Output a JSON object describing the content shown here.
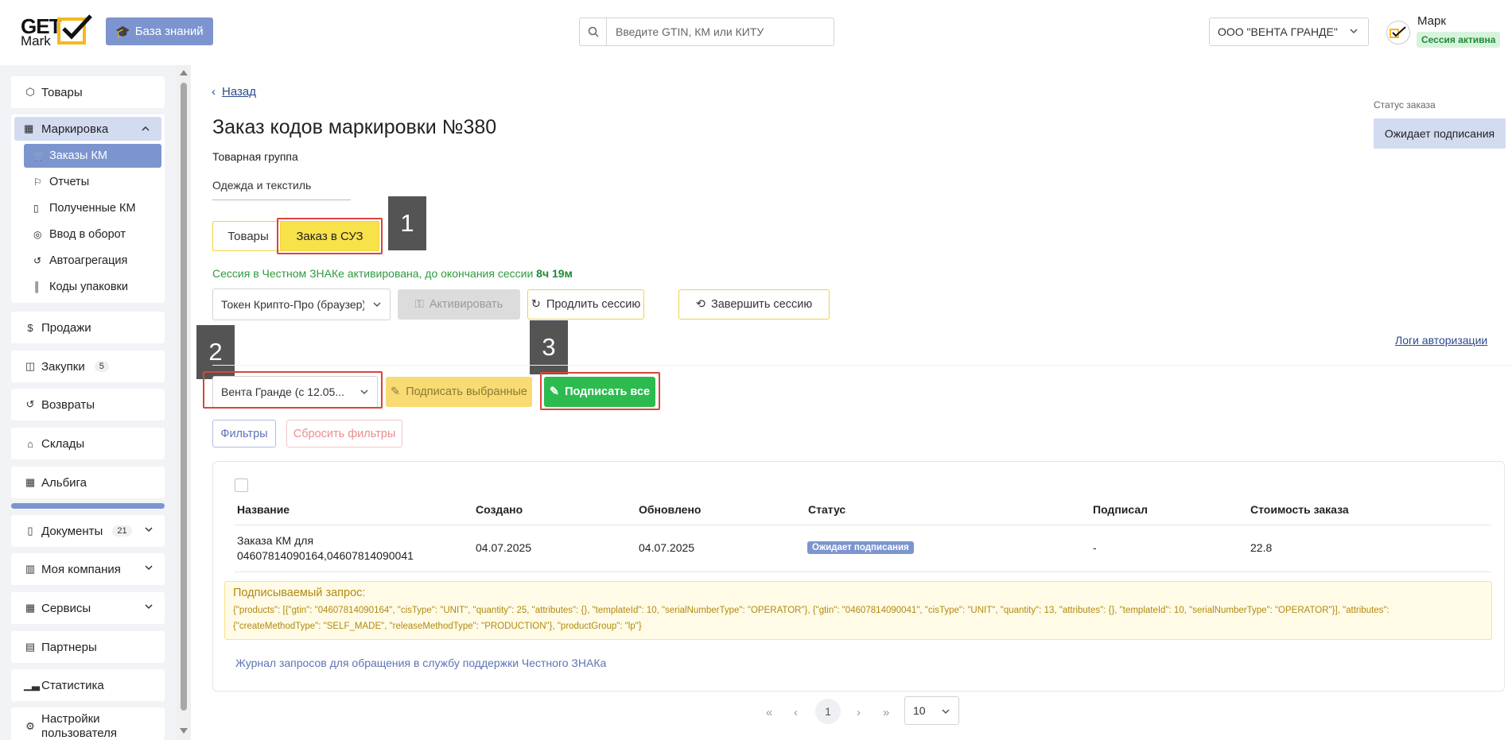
{
  "header": {
    "logo_top": "GET",
    "logo_bottom": "Mark",
    "knowledge_base_label": "База знаний",
    "search_placeholder": "Введите GTIN, КМ или КИТУ",
    "org_select": "ООО \"ВЕНТА ГРАНДЕ\"",
    "user_name": "Марк",
    "session_badge": "Сессия активна"
  },
  "sidebar": {
    "goods": "Товары",
    "marking": "Маркировка",
    "marking_sub": [
      "Заказы КМ",
      "Отчеты",
      "Полученные КМ",
      "Ввод в оборот",
      "Автоагрегация",
      "Коды упаковки"
    ],
    "sales": "Продажи",
    "purchases": "Закупки",
    "purchases_count": "5",
    "returns": "Возвраты",
    "warehouses": "Склады",
    "albiga": "Альбига",
    "documents": "Документы",
    "documents_count": "21",
    "my_company": "Моя компания",
    "services": "Сервисы",
    "partners": "Партнеры",
    "statistics": "Статистика",
    "user_settings": "Настройки пользователя"
  },
  "main": {
    "back": "Назад",
    "title": "Заказ кодов маркировки №380",
    "product_group_label": "Товарная группа",
    "product_group_value": "Одежда и текстиль",
    "tabs": [
      "Товары",
      "Заказ в СУЗ"
    ],
    "steps": [
      "1",
      "2",
      "3"
    ],
    "session_msg": "Сессия в Честном ЗНАКе активирована, до окончания сессии",
    "session_time": "8ч 19м",
    "token_select": "Токен Крипто-Про (браузер)",
    "activate_btn": "Активировать",
    "extend_btn": "Продлить сессию",
    "end_btn": "Завершить сессию",
    "logs_link": "Логи авторизации",
    "signer_select": "Вента Гранде (с 12.05...",
    "sign_selected_btn": "Подписать выбранные",
    "sign_all_btn": "Подписать все",
    "filters_btn": "Фильтры",
    "reset_filters_btn": "Сбросить фильтры",
    "order_status_label": "Статус заказа",
    "order_status_value": "Ожидает подписания"
  },
  "table": {
    "columns": [
      "Название",
      "Создано",
      "Обновлено",
      "Статус",
      "Подписал",
      "Стоимость заказа"
    ],
    "row": {
      "name_line1": "Заказа КМ для",
      "name_line2": "04607814090164,04607814090041",
      "created": "04.07.2025",
      "updated": "04.07.2025",
      "status": "Ожидает подписания",
      "signed_by": "-",
      "cost": "22.8"
    },
    "request_title": "Подписываемый запрос:",
    "request_body_1": "{\"products\": [{\"gtin\": \"04607814090164\", \"cisType\": \"UNIT\", \"quantity\": 25, \"attributes\": {}, \"templateId\": 10, \"serialNumberType\": \"OPERATOR\"}, {\"gtin\": \"04607814090041\", \"cisType\": \"UNIT\", \"quantity\": 13, \"attributes\": {}, \"templateId\": 10, \"serialNumberType\": \"OPERATOR\"}], \"attributes\":",
    "request_body_2": "{\"createMethodType\": \"SELF_MADE\", \"releaseMethodType\": \"PRODUCTION\"}, \"productGroup\": \"lp\"}",
    "journal_link": "Журнал запросов для обращения в службу поддержки Честного ЗНАКа"
  },
  "pagination": {
    "first": "«",
    "prev": "‹",
    "current": "1",
    "next": "›",
    "last": "»",
    "page_size": "10"
  },
  "colors": {
    "accent": "#7d95cf",
    "yellow": "#f8e24a",
    "green": "#2dbb4f",
    "red_outline": "#d9453a"
  }
}
